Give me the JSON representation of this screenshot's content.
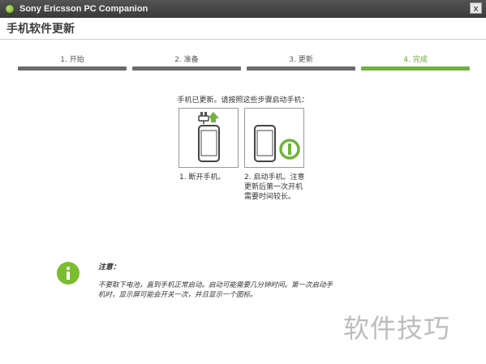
{
  "window": {
    "app_title": "Sony Ericsson PC Companion",
    "close_symbol": "x",
    "logo_icon": "sony-ericsson-logo"
  },
  "header": {
    "page_title": "手机软件更新"
  },
  "steps": [
    {
      "label": "1. 开始",
      "active": false
    },
    {
      "label": "2. 准备",
      "active": false
    },
    {
      "label": "3. 更新",
      "active": false
    },
    {
      "label": "4. 完成",
      "active": true
    }
  ],
  "main": {
    "instruction": "手机已更新。请按照这些步骤启动手机：",
    "step_cards": [
      {
        "icon": "phone-unplug-icon",
        "caption": "1. 断开手机。"
      },
      {
        "icon": "phone-power-on-icon",
        "caption": "2. 启动手机。注意更新后第一次开机需要时间较长。"
      }
    ]
  },
  "note": {
    "title": "注意：",
    "text": "不要取下电池，直到手机正常启动。启动可能需要几分钟时间。第一次启动手机时，显示屏可能会开关一次，并且显示一个图标。"
  },
  "watermark": "软件技巧",
  "colors": {
    "accent_green": "#6fb33a",
    "inactive_bar": "#6b6b6b",
    "titlebar": "#454545"
  }
}
